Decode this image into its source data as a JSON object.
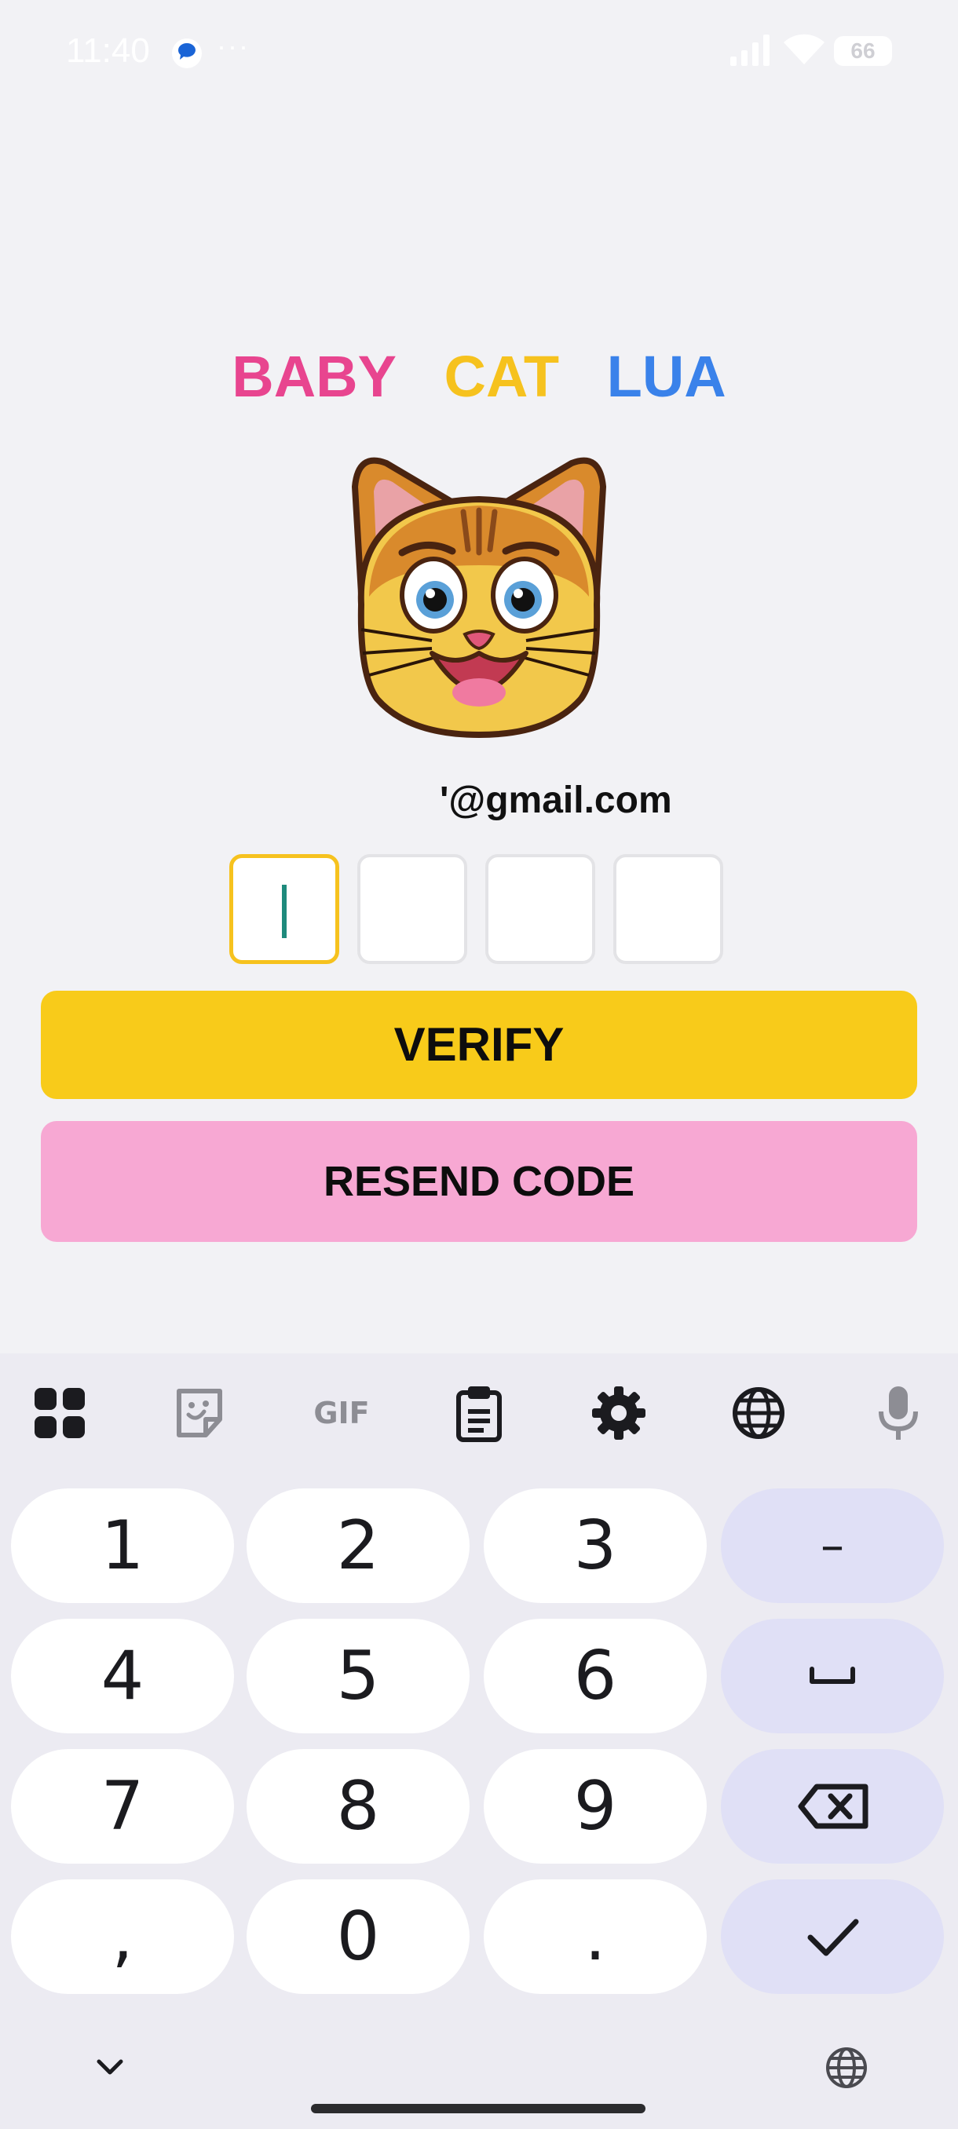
{
  "status_bar": {
    "time": "11:40",
    "overflow": "···",
    "battery": "66"
  },
  "title": {
    "word1": "BABY",
    "word2": "CAT",
    "word3": "LUA",
    "color1": "#e8458f",
    "color2": "#f6c21e",
    "color3": "#3a82ea"
  },
  "logo": {
    "icon": "cat-face-icon"
  },
  "email": "'@gmail.com",
  "otp": {
    "digits": [
      "",
      "",
      "",
      ""
    ],
    "active_index": 0
  },
  "buttons": {
    "verify": "VERIFY",
    "resend": "RESEND CODE",
    "verify_color": "#f8cb1a",
    "resend_color": "#f7a8d3"
  },
  "keyboard": {
    "toolbar": [
      "apps-grid-icon",
      "sticker-icon",
      "gif-icon",
      "clipboard-icon",
      "gear-icon",
      "globe-icon",
      "microphone-icon"
    ],
    "gif_label": "GIF",
    "rows": [
      [
        "1",
        "2",
        "3",
        "–"
      ],
      [
        "4",
        "5",
        "6",
        "space-icon"
      ],
      [
        "7",
        "8",
        "9",
        "backspace-icon"
      ],
      [
        ",",
        "0",
        ".",
        "checkmark-icon"
      ]
    ]
  }
}
